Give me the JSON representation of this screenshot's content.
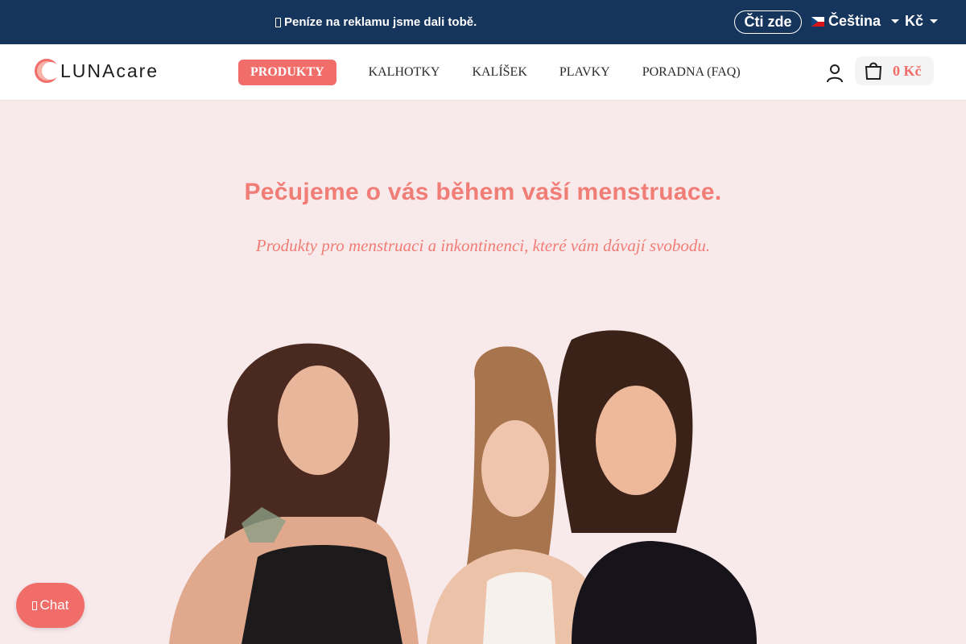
{
  "topbar": {
    "announcement": "Peníze na reklamu jsme dali tobě.",
    "read_button": "Čti zde",
    "language": "Čeština",
    "currency": "Kč"
  },
  "header": {
    "logo_text": "LUNAcare",
    "nav": [
      {
        "label": "PRODUKTY",
        "active": true
      },
      {
        "label": "KALHOTKY"
      },
      {
        "label": "KALÍŠEK"
      },
      {
        "label": "PLAVKY"
      },
      {
        "label": "PORADNA (FAQ)"
      }
    ],
    "cart_total": "0 Kč"
  },
  "hero": {
    "title": "Pečujeme o vás během vaší menstruace.",
    "subtitle": "Produkty pro menstruaci a inkontinenci, které vám dávají svobodu."
  },
  "chat": {
    "label": "Chat"
  },
  "colors": {
    "topbar_bg": "#16355c",
    "accent": "#f16d6a",
    "hero_bg": "#f8e9ea",
    "hero_text": "#f07d76"
  },
  "icons": [
    "megaphone-icon",
    "czech-flag-icon",
    "user-icon",
    "shopping-bag-icon",
    "chat-icon",
    "logo-moon-icon"
  ]
}
